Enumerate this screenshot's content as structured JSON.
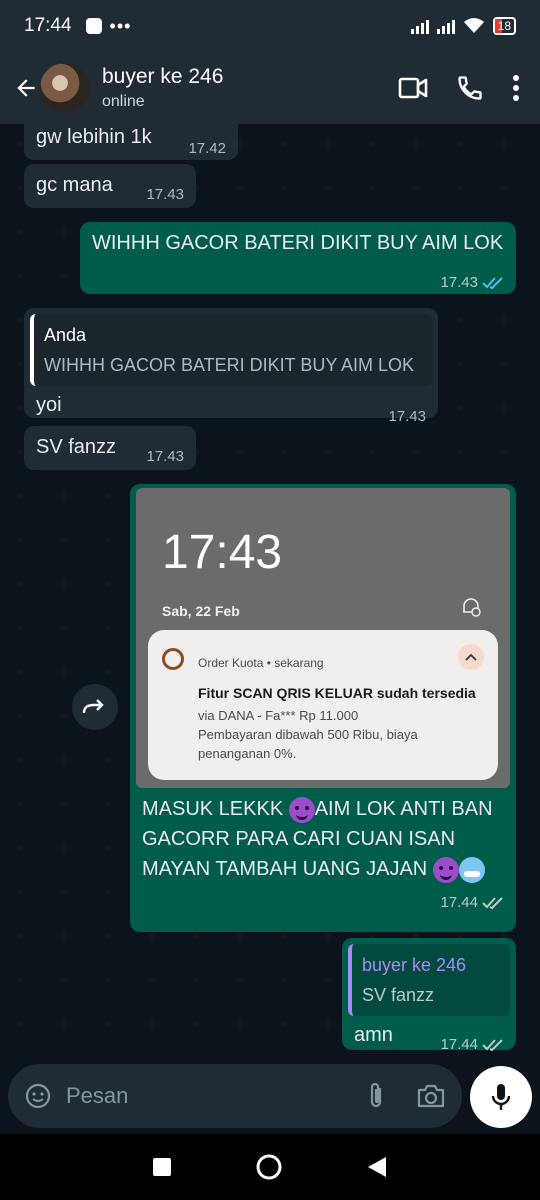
{
  "status_bar": {
    "time": "17:44",
    "dots": "•••",
    "battery": "18"
  },
  "header": {
    "contact_name": "buyer ke 246",
    "status": "online"
  },
  "messages": {
    "m1": {
      "text": "gw lebihin 1k",
      "time": "17.42"
    },
    "m2": {
      "text": "gc mana",
      "time": "17.43"
    },
    "m3": {
      "text": "WIHHH GACOR BATERI DIKIT BUY AIM LOK",
      "time": "17.43"
    },
    "m4": {
      "quote_name": "Anda",
      "quote_text": "WIHHH GACOR BATERI DIKIT BUY AIM LOK",
      "text": "yoi",
      "time": "17.43"
    },
    "m5": {
      "text": "SV fanzz",
      "time": "17.43"
    },
    "m6": {
      "image": {
        "lock_time": "17:43",
        "lock_date": "Sab, 22 Feb",
        "notif_app": "Order Kuota • sekarang",
        "notif_title": "Fitur SCAN QRIS KELUAR sudah tersedia",
        "notif_line1": "via DANA - Fa*** Rp 11.000",
        "notif_line2": "Pembayaran dibawah 500 Ribu, biaya penanganan 0%."
      },
      "caption_part1": "MASUK LEKKK ",
      "caption_part2": "AIM LOK ANTI BAN GACORR PARA CARI CUAN ISAN MAYAN TAMBAH UANG JAJAN ",
      "time": "17.44"
    },
    "m7": {
      "quote_name": "buyer ke 246",
      "quote_text": "SV fanzz",
      "text": "amn",
      "time": "17.44"
    }
  },
  "input": {
    "placeholder": "Pesan"
  },
  "colors": {
    "incoming": "#1f2c34",
    "outgoing": "#005c4b",
    "tick_read": "#53bdeb",
    "quote_anda": "#ffffff",
    "quote_buyer": "#a78bfa"
  }
}
